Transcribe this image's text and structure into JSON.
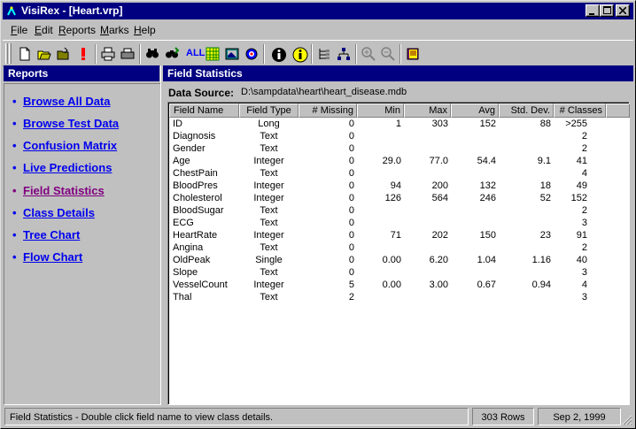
{
  "window": {
    "title": "VisiRex - [Heart.vrp]",
    "controls": {
      "minimize": "_",
      "maximize": "□",
      "close": "×"
    }
  },
  "menu": {
    "items": [
      {
        "label": "File",
        "underline": "F",
        "rest": "ile"
      },
      {
        "label": "Edit",
        "underline": "E",
        "rest": "dit"
      },
      {
        "label": "Reports",
        "underline": "R",
        "rest": "eports"
      },
      {
        "label": "Marks",
        "underline": "M",
        "rest": "arks"
      },
      {
        "label": "Help",
        "underline": "H",
        "rest": "elp"
      }
    ]
  },
  "toolbar": {
    "buttons": [
      "new-icon",
      "open-icon",
      "save-folder-icon",
      "exclamation-icon",
      "print-icon",
      "print-preview-icon",
      "find-icon",
      "find-next-icon",
      "all-icon",
      "grid-icon",
      "image-icon",
      "settings-icon",
      "info-icon",
      "info-yellow-icon",
      "tree-icon",
      "hierarchy-icon",
      "zoom-in-icon",
      "zoom-out-icon",
      "book-icon"
    ],
    "all_label": "ALL"
  },
  "left_pane": {
    "header": "Reports",
    "items": [
      {
        "label": "Browse All Data",
        "active": false
      },
      {
        "label": "Browse Test Data",
        "active": false
      },
      {
        "label": "Confusion Matrix",
        "active": false
      },
      {
        "label": "Live Predictions",
        "active": false
      },
      {
        "label": "Field Statistics",
        "active": true
      },
      {
        "label": "Class Details",
        "active": false
      },
      {
        "label": "Tree Chart",
        "active": false
      },
      {
        "label": "Flow Chart",
        "active": false
      }
    ]
  },
  "right_pane": {
    "header": "Field Statistics",
    "data_source_label": "Data Source:",
    "data_source_path": "D:\\sampdata\\heart\\heart_disease.mdb",
    "columns": [
      "Field Name",
      "Field Type",
      "# Missing",
      "Min",
      "Max",
      "Avg",
      "Std. Dev.",
      "# Classes"
    ],
    "rows": [
      [
        "ID",
        "Long",
        "0",
        "1",
        "303",
        "152",
        "88",
        ">255"
      ],
      [
        "Diagnosis",
        "Text",
        "0",
        "",
        "",
        "",
        "",
        "2"
      ],
      [
        "Gender",
        "Text",
        "0",
        "",
        "",
        "",
        "",
        "2"
      ],
      [
        "Age",
        "Integer",
        "0",
        "29.0",
        "77.0",
        "54.4",
        "9.1",
        "41"
      ],
      [
        "ChestPain",
        "Text",
        "0",
        "",
        "",
        "",
        "",
        "4"
      ],
      [
        "BloodPres",
        "Integer",
        "0",
        "94",
        "200",
        "132",
        "18",
        "49"
      ],
      [
        "Cholesterol",
        "Integer",
        "0",
        "126",
        "564",
        "246",
        "52",
        "152"
      ],
      [
        "BloodSugar",
        "Text",
        "0",
        "",
        "",
        "",
        "",
        "2"
      ],
      [
        "ECG",
        "Text",
        "0",
        "",
        "",
        "",
        "",
        "3"
      ],
      [
        "HeartRate",
        "Integer",
        "0",
        "71",
        "202",
        "150",
        "23",
        "91"
      ],
      [
        "Angina",
        "Text",
        "0",
        "",
        "",
        "",
        "",
        "2"
      ],
      [
        "OldPeak",
        "Single",
        "0",
        "0.00",
        "6.20",
        "1.04",
        "1.16",
        "40"
      ],
      [
        "Slope",
        "Text",
        "0",
        "",
        "",
        "",
        "",
        "3"
      ],
      [
        "VesselCount",
        "Integer",
        "5",
        "0.00",
        "3.00",
        "0.67",
        "0.94",
        "4"
      ],
      [
        "Thal",
        "Text",
        "2",
        "",
        "",
        "",
        "",
        "3"
      ]
    ]
  },
  "status_bar": {
    "message": "Field Statistics - Double click field name to view class details.",
    "rows": "303 Rows",
    "date": "Sep 2, 1999"
  },
  "colors": {
    "title_bar": "#000080",
    "link": "#0000ee",
    "visited_link": "#800080",
    "face": "#c0c0c0"
  }
}
